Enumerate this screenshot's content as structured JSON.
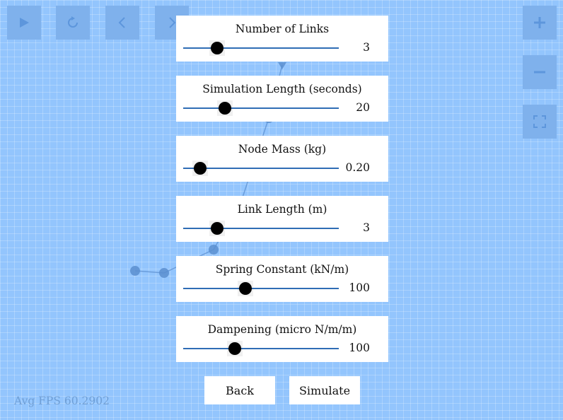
{
  "toolbar": {
    "left_icons": [
      "play-icon",
      "reset-icon",
      "back-arrow-icon",
      "forward-arrow-icon"
    ],
    "right_icons": [
      "zoom-in-icon",
      "zoom-out-icon",
      "fullscreen-icon"
    ]
  },
  "sliders": [
    {
      "label": "Number of Links",
      "value": "3",
      "fraction": 0.22
    },
    {
      "label": "Simulation Length (seconds)",
      "value": "20",
      "fraction": 0.27
    },
    {
      "label": "Node Mass (kg)",
      "value": "0.20",
      "fraction": 0.11
    },
    {
      "label": "Link Length (m)",
      "value": "3",
      "fraction": 0.22
    },
    {
      "label": "Spring Constant (kN/m)",
      "value": "100",
      "fraction": 0.4
    },
    {
      "label": "Dampening (micro N/m/m)",
      "value": "100",
      "fraction": 0.33
    }
  ],
  "actions": {
    "back": "Back",
    "simulate": "Simulate"
  },
  "status": {
    "fps": "Avg FPS 60.2902"
  },
  "colors": {
    "background": "#93c5fd",
    "track": "#2f6db5",
    "thumb": "#000000",
    "toolbar_button": "#7fb1ec",
    "toolbar_icon": "#5d96dc",
    "chain": "#5b8fd0"
  }
}
